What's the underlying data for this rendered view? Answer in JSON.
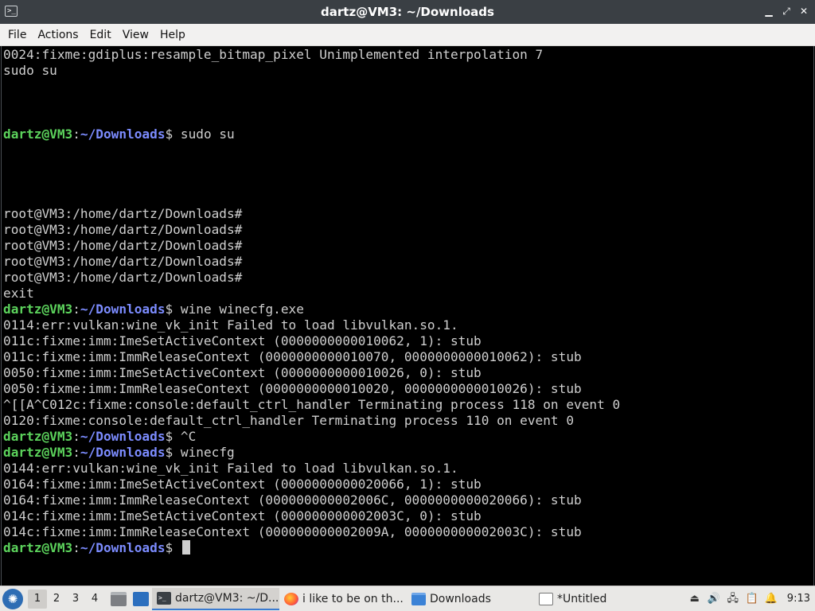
{
  "window": {
    "title": "dartz@VM3: ~/Downloads"
  },
  "menu": [
    "File",
    "Actions",
    "Edit",
    "View",
    "Help"
  ],
  "terminal": {
    "lines": [
      [
        {
          "t": "0024:fixme:gdiplus:resample_bitmap_pixel Unimplemented interpolation 7",
          "c": "plain"
        }
      ],
      [
        {
          "t": "sudo su",
          "c": "plain"
        }
      ],
      [],
      [],
      [],
      [
        {
          "t": "dartz@VM3",
          "c": "user"
        },
        {
          "t": ":",
          "c": "plain"
        },
        {
          "t": "~/Downloads",
          "c": "path"
        },
        {
          "t": "$ sudo su",
          "c": "plain"
        }
      ],
      [],
      [],
      [],
      [],
      [
        {
          "t": "root@VM3:/home/dartz/Downloads#",
          "c": "plain"
        }
      ],
      [
        {
          "t": "root@VM3:/home/dartz/Downloads#",
          "c": "plain"
        }
      ],
      [
        {
          "t": "root@VM3:/home/dartz/Downloads#",
          "c": "plain"
        }
      ],
      [
        {
          "t": "root@VM3:/home/dartz/Downloads#",
          "c": "plain"
        }
      ],
      [
        {
          "t": "root@VM3:/home/dartz/Downloads#",
          "c": "plain"
        }
      ],
      [
        {
          "t": "exit",
          "c": "plain"
        }
      ],
      [
        {
          "t": "dartz@VM3",
          "c": "user"
        },
        {
          "t": ":",
          "c": "plain"
        },
        {
          "t": "~/Downloads",
          "c": "path"
        },
        {
          "t": "$ wine winecfg.exe",
          "c": "plain"
        }
      ],
      [
        {
          "t": "0114:err:vulkan:wine_vk_init Failed to load libvulkan.so.1.",
          "c": "plain"
        }
      ],
      [
        {
          "t": "011c:fixme:imm:ImeSetActiveContext (0000000000010062, 1): stub",
          "c": "plain"
        }
      ],
      [
        {
          "t": "011c:fixme:imm:ImmReleaseContext (0000000000010070, 0000000000010062): stub",
          "c": "plain"
        }
      ],
      [
        {
          "t": "0050:fixme:imm:ImeSetActiveContext (0000000000010026, 0): stub",
          "c": "plain"
        }
      ],
      [
        {
          "t": "0050:fixme:imm:ImmReleaseContext (0000000000010020, 0000000000010026): stub",
          "c": "plain"
        }
      ],
      [
        {
          "t": "^[[A^C012c:fixme:console:default_ctrl_handler Terminating process 118 on event 0",
          "c": "plain"
        }
      ],
      [
        {
          "t": "0120:fixme:console:default_ctrl_handler Terminating process 110 on event 0",
          "c": "plain"
        }
      ],
      [
        {
          "t": "dartz@VM3",
          "c": "user"
        },
        {
          "t": ":",
          "c": "plain"
        },
        {
          "t": "~/Downloads",
          "c": "path"
        },
        {
          "t": "$ ^C",
          "c": "plain"
        }
      ],
      [
        {
          "t": "dartz@VM3",
          "c": "user"
        },
        {
          "t": ":",
          "c": "plain"
        },
        {
          "t": "~/Downloads",
          "c": "path"
        },
        {
          "t": "$ winecfg",
          "c": "plain"
        }
      ],
      [
        {
          "t": "0144:err:vulkan:wine_vk_init Failed to load libvulkan.so.1.",
          "c": "plain"
        }
      ],
      [
        {
          "t": "0164:fixme:imm:ImeSetActiveContext (0000000000020066, 1): stub",
          "c": "plain"
        }
      ],
      [
        {
          "t": "0164:fixme:imm:ImmReleaseContext (000000000002006C, 0000000000020066): stub",
          "c": "plain"
        }
      ],
      [
        {
          "t": "014c:fixme:imm:ImeSetActiveContext (000000000002003C, 0): stub",
          "c": "plain"
        }
      ],
      [
        {
          "t": "014c:fixme:imm:ImmReleaseContext (000000000002009A, 000000000002003C): stub",
          "c": "plain"
        }
      ],
      [
        {
          "t": "dartz@VM3",
          "c": "user"
        },
        {
          "t": ":",
          "c": "plain"
        },
        {
          "t": "~/Downloads",
          "c": "path"
        },
        {
          "t": "$ ",
          "c": "plain"
        }
      ]
    ],
    "colors": {
      "user": "#5cd35c",
      "path": "#7c8cff",
      "text": "#cfcfcf",
      "background": "#000000"
    }
  },
  "taskbar": {
    "workspaces": [
      "1",
      "2",
      "3",
      "4"
    ],
    "active_workspace": "1",
    "tasks": [
      {
        "label": "dartz@VM3: ~/D...",
        "icon": "terminal-icon",
        "active": true
      },
      {
        "label": "i like to be on th...",
        "icon": "firefox-icon",
        "active": false
      },
      {
        "label": "Downloads",
        "icon": "folder-icon",
        "active": false
      },
      {
        "label": "*Untitled",
        "icon": "text-editor-icon",
        "active": false
      }
    ],
    "clock": "9:13"
  }
}
